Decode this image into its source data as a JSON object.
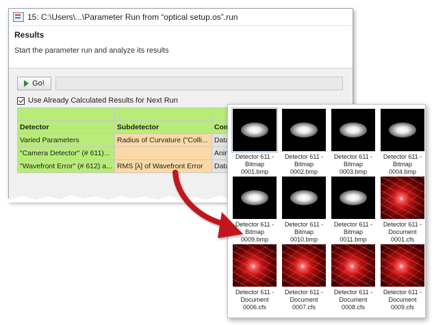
{
  "window": {
    "title": "15: C:\\Users\\...\\Parameter Run from “optical setup.os”.run",
    "section_title": "Results",
    "section_subtitle": "Start the parameter run and analyze its results",
    "go_label": "Go!",
    "checkbox_label": "Use Already Calculated Results for Next Run",
    "checkbox_checked": true
  },
  "table": {
    "headers": [
      "Detector",
      "Subdetector",
      "Com"
    ],
    "rows": [
      [
        "Varied Parameters",
        "Radius of Curvature (\"Colli...",
        "Data"
      ],
      [
        "\"Camera Detector\" (# 611)...",
        "",
        "Anim"
      ],
      [
        "\"Wavefront Error\" (# 612) a...",
        "RMS [λ] of Wavefront Error",
        "Data"
      ]
    ]
  },
  "files": [
    {
      "caption": [
        "Detector 611 -",
        "Bitmap",
        "0001.bmp"
      ],
      "icon": "beam-spot-thumbnail",
      "selected": true
    },
    {
      "caption": [
        "Detector 611 -",
        "Bitmap",
        "0002.bmp"
      ],
      "icon": "beam-spot-thumbnail"
    },
    {
      "caption": [
        "Detector 611 -",
        "Bitmap",
        "0003.bmp"
      ],
      "icon": "beam-spot-thumbnail"
    },
    {
      "caption": [
        "Detector 611 -",
        "Bitmap",
        "0004.bmp"
      ],
      "icon": "beam-spot-thumbnail"
    },
    {
      "caption": [
        "Detector 611 -",
        "Bitmap",
        "0009.bmp"
      ],
      "icon": "beam-spot-thumbnail"
    },
    {
      "caption": [
        "Detector 611 -",
        "Bitmap",
        "0010.bmp"
      ],
      "icon": "beam-spot-thumbnail"
    },
    {
      "caption": [
        "Detector 611 -",
        "Bitmap",
        "0011.bmp"
      ],
      "icon": "beam-spot-thumbnail"
    },
    {
      "caption": [
        "Detector 611 -",
        "Document",
        "0001.cfs"
      ],
      "icon": "laser-rays-thumbnail"
    },
    {
      "caption": [
        "Detector 611 -",
        "Document",
        "0006.cfs"
      ],
      "icon": "laser-rays-thumbnail"
    },
    {
      "caption": [
        "Detector 611 -",
        "Document",
        "0007.cfs"
      ],
      "icon": "laser-rays-thumbnail"
    },
    {
      "caption": [
        "Detector 611 -",
        "Document",
        "0008.cfs"
      ],
      "icon": "laser-rays-thumbnail"
    },
    {
      "caption": [
        "Detector 611 -",
        "Document",
        "0009.cfs"
      ],
      "icon": "laser-rays-thumbnail"
    }
  ],
  "colors": {
    "detector_column": "#b7ec78",
    "subdetector_column": "#fbd9a6",
    "arrow": "#c1141b"
  }
}
